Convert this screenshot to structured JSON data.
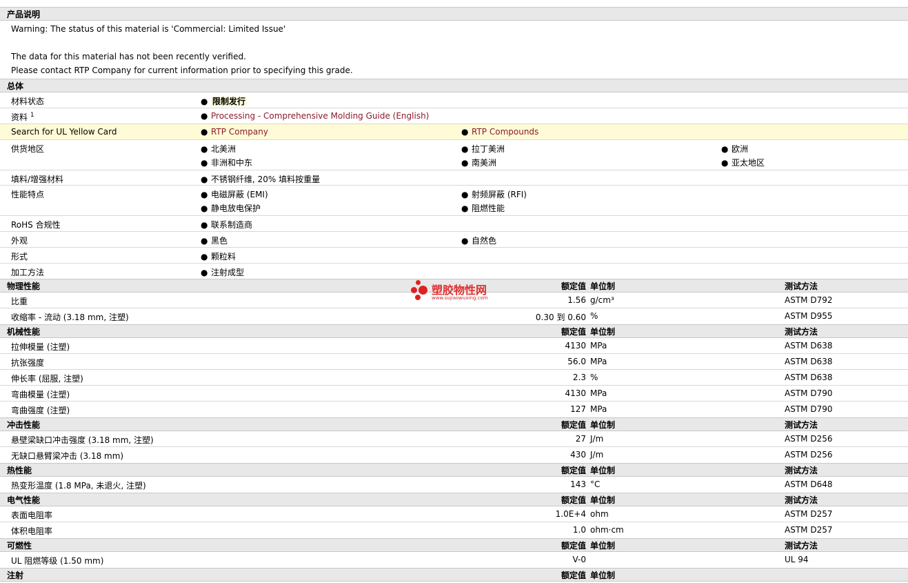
{
  "product_desc": {
    "header": "产品说明",
    "lines": [
      "Warning: The status of this material is 'Commercial: Limited Issue'",
      "The data for this material has not been recently verified.",
      "Please contact RTP Company for current information prior to specifying this grade."
    ]
  },
  "general": {
    "header": "总体",
    "status": {
      "label": "材料状态",
      "value": "限制发行"
    },
    "docs": {
      "label": "资料",
      "sup": "1",
      "value": "Processing - Comprehensive Molding Guide (English)"
    },
    "ul": {
      "label": "Search for UL Yellow Card",
      "v1": "RTP Company",
      "v2": "RTP Compounds"
    },
    "supply": {
      "label": "供货地区",
      "items": [
        "北美洲",
        "拉丁美洲",
        "欧洲",
        "非洲和中东",
        "南美洲",
        "亚太地区"
      ]
    },
    "filler": {
      "label": "填料/增强材料",
      "value": "不锈钢纤维, 20% 填料按重量"
    },
    "features": {
      "label": "性能特点",
      "items": [
        "电磁屏蔽 (EMI)",
        "射频屏蔽 (RFI)",
        "静电放电保护",
        "阻燃性能"
      ]
    },
    "rohs": {
      "label": "RoHS 合规性",
      "value": "联系制造商"
    },
    "appearance": {
      "label": "外观",
      "items": [
        "黑色",
        "自然色"
      ]
    },
    "form": {
      "label": "形式",
      "value": "颗粒料"
    },
    "process": {
      "label": "加工方法",
      "value": "注射成型"
    }
  },
  "cols": {
    "value": "额定值",
    "unit": "单位制",
    "test": "测试方法"
  },
  "watermark": {
    "cn": "塑胶物性网",
    "url": "www.sujiaowuxing.com"
  },
  "physical": {
    "header": "物理性能",
    "rows": [
      {
        "label": "比重",
        "value": "1.56",
        "unit": "g/cm³",
        "test": "ASTM D792"
      },
      {
        "label": "收缩率 - 流动 (3.18 mm, 注塑)",
        "value": "0.30 到 0.60",
        "unit": "%",
        "test": "ASTM D955"
      }
    ]
  },
  "mechanical": {
    "header": "机械性能",
    "rows": [
      {
        "label": "拉伸模量 (注塑)",
        "value": "4130",
        "unit": "MPa",
        "test": "ASTM D638"
      },
      {
        "label": "抗张强度",
        "value": "56.0",
        "unit": "MPa",
        "test": "ASTM D638"
      },
      {
        "label": "伸长率 (屈服, 注塑)",
        "value": "2.3",
        "unit": "%",
        "test": "ASTM D638"
      },
      {
        "label": "弯曲模量 (注塑)",
        "value": "4130",
        "unit": "MPa",
        "test": "ASTM D790"
      },
      {
        "label": "弯曲强度 (注塑)",
        "value": "127",
        "unit": "MPa",
        "test": "ASTM D790"
      }
    ]
  },
  "impact": {
    "header": "冲击性能",
    "rows": [
      {
        "label": "悬壁梁缺口冲击强度 (3.18 mm, 注塑)",
        "value": "27",
        "unit": "J/m",
        "test": "ASTM D256"
      },
      {
        "label": "无缺口悬臂梁冲击 (3.18 mm)",
        "value": "430",
        "unit": "J/m",
        "test": "ASTM D256"
      }
    ]
  },
  "thermal": {
    "header": "热性能",
    "rows": [
      {
        "label": "热变形温度 (1.8 MPa, 未退火, 注塑)",
        "value": "143",
        "unit": "°C",
        "test": "ASTM D648"
      }
    ]
  },
  "electrical": {
    "header": "电气性能",
    "rows": [
      {
        "label": "表面电阻率",
        "value": "1.0E+4",
        "unit": "ohm",
        "test": "ASTM D257"
      },
      {
        "label": "体积电阻率",
        "value": "1.0",
        "unit": "ohm·cm",
        "test": "ASTM D257"
      }
    ]
  },
  "flammability": {
    "header": "可燃性",
    "rows": [
      {
        "label": "UL 阻燃等级 (1.50 mm)",
        "value": "V-0",
        "unit": "",
        "test": "UL 94"
      }
    ]
  },
  "injection": {
    "header": "注射"
  }
}
